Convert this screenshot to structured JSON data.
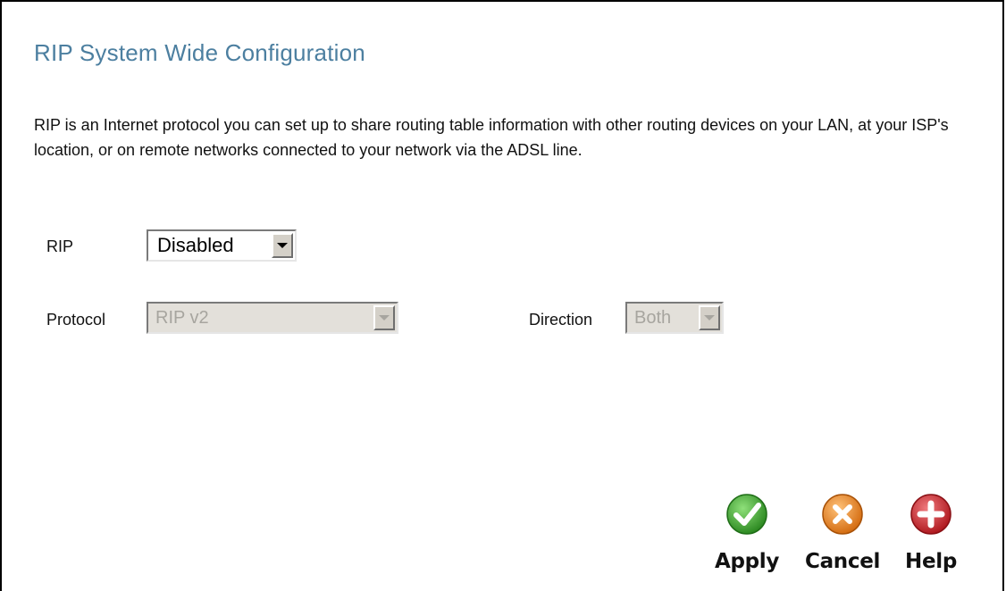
{
  "page": {
    "title": "RIP System Wide Configuration",
    "description": "RIP is an Internet protocol you can set up to share routing table information with other routing devices on your LAN, at your ISP's location, or on remote networks connected to your network via the ADSL line."
  },
  "form": {
    "rip": {
      "label": "RIP",
      "value": "Disabled"
    },
    "protocol": {
      "label": "Protocol",
      "value": "RIP v2",
      "disabled": true
    },
    "direction": {
      "label": "Direction",
      "value": "Both",
      "disabled": true
    }
  },
  "actions": {
    "apply": {
      "label": "Apply",
      "icon": "check-icon",
      "color": "#3aa12c"
    },
    "cancel": {
      "label": "Cancel",
      "icon": "x-icon",
      "color": "#e9892a"
    },
    "help": {
      "label": "Help",
      "icon": "plus-icon",
      "color": "#c5242a"
    }
  }
}
